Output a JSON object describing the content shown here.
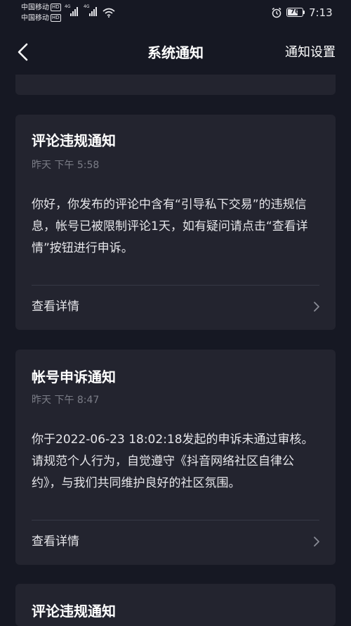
{
  "status_bar": {
    "carrier1": "中国移动",
    "carrier2": "中国移动",
    "hd": "HD",
    "net1": "4G",
    "net2": "4G",
    "battery": "76",
    "battery_level": 0.76,
    "time": "7:13"
  },
  "nav": {
    "title": "系统通知",
    "action": "通知设置"
  },
  "notifications": [
    {
      "title": "评论违规通知",
      "time": "昨天 下午 5:58",
      "body": "你好，你发布的评论中含有“引导私下交易”的违规信息，帐号已被限制评论1天，如有疑问请点击“查看详情”按钮进行申诉。",
      "link": "查看详情"
    },
    {
      "title": "帐号申诉通知",
      "time": "昨天 下午 8:47",
      "body": "你于2022-06-23 18:02:18发起的申诉未通过审核。请规范个人行为，自觉遵守《抖音网络社区自律公约》，与我们共同维护良好的社区氛围。",
      "link": "查看详情"
    },
    {
      "title": "评论违规通知"
    }
  ],
  "colors": {
    "background": "#161823",
    "card": "#23242f",
    "secondary_text": "#7b7d87"
  }
}
